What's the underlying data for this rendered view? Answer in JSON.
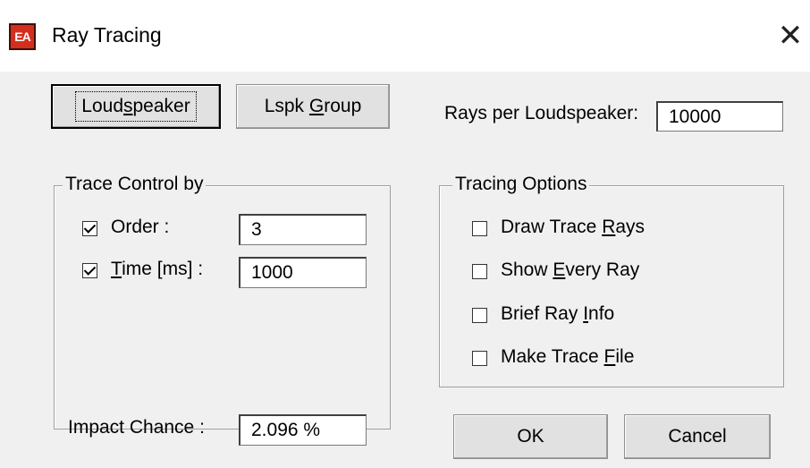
{
  "window": {
    "title": "Ray Tracing",
    "app_icon_text": "EA"
  },
  "buttons": {
    "loudspeaker": {
      "pre": "Loud",
      "ul": "s",
      "post": "peaker"
    },
    "lspk_group": {
      "pre": "Lspk ",
      "ul": "G",
      "post": "roup"
    },
    "ok": "OK",
    "cancel": "Cancel"
  },
  "rays": {
    "label": "Rays per Loudspeaker:",
    "value": "10000"
  },
  "trace_control": {
    "title": "Trace Control by",
    "order": {
      "label": "Order :",
      "checked": true,
      "value": "3"
    },
    "time": {
      "label_ul": "T",
      "label_rest": "ime [ms] :",
      "checked": true,
      "value": "1000"
    }
  },
  "tracing_options": {
    "title": "Tracing Options",
    "items": [
      {
        "pre": "Draw Trace ",
        "ul": "R",
        "post": "ays",
        "checked": false
      },
      {
        "pre": "Show ",
        "ul": "E",
        "post": "very Ray",
        "checked": false
      },
      {
        "pre": "Brief Ray ",
        "ul": "I",
        "post": "nfo",
        "checked": false
      },
      {
        "pre": "Make Trace ",
        "ul": "F",
        "post": "ile",
        "checked": false
      }
    ]
  },
  "impact": {
    "label": "Impact Chance :",
    "value": "2.096 %"
  }
}
